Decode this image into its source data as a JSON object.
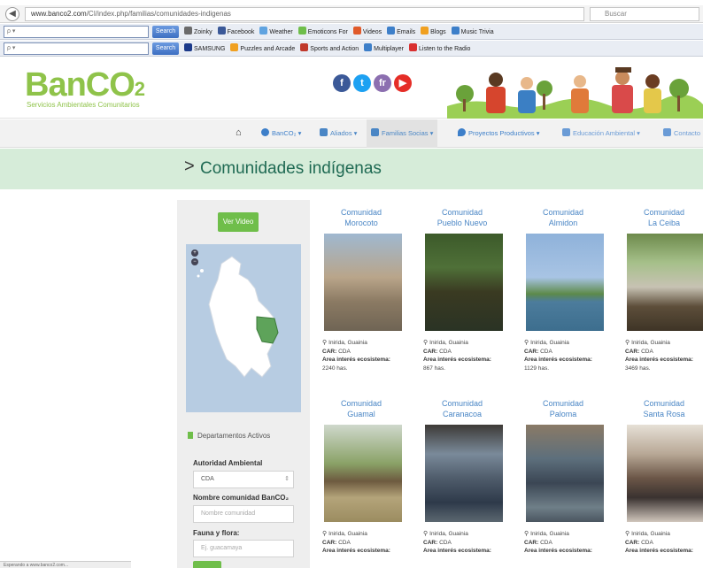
{
  "browser": {
    "url_host": "www.banco2.com",
    "url_path": "/CI/index.php/familias/comunidades-indigenas",
    "search_placeholder": "Buscar",
    "toolbar1_input": "",
    "toolbar2_input": "",
    "search_button": "Search",
    "toolbar1_items": [
      "Zoinky",
      "Facebook",
      "Weather",
      "Emoticons For",
      "Videos",
      "Emails",
      "Blogs",
      "Music Trivia"
    ],
    "toolbar2_items": [
      "SAMSUNG",
      "Puzzles and Arcade",
      "Sports and Action",
      "Multiplayer",
      "Listen to the Radio"
    ]
  },
  "header": {
    "logo_main": "BanCO",
    "logo_sub": "2",
    "tagline": "Servicios Ambientales Comunitarios",
    "social": [
      "f",
      "t",
      "fr",
      "▶"
    ]
  },
  "nav": {
    "home_icon": "home-icon",
    "items": [
      {
        "label": "BanCO₂ ▾",
        "color": "#3d7fc9"
      },
      {
        "label": "Aliados ▾",
        "color": "#4a86c5"
      },
      {
        "label": "Familias Socias ▾",
        "color": "#4a86c5"
      },
      {
        "label": "Proyectos Productivos ▾",
        "color": "#3d7fc9"
      },
      {
        "label": "Educación Ambiental ▾",
        "color": "#6a9bd6"
      },
      {
        "label": "Contacto",
        "color": "#6a9bd6"
      }
    ]
  },
  "page": {
    "title": "Comunidades indígenas"
  },
  "sidebar": {
    "video_button": "Ver Video",
    "legend": "Departamentos Activos",
    "authority_label": "Autoridad Ambiental",
    "authority_value": "CDA",
    "community_label": "Nombre comunidad BanCO₂",
    "community_placeholder": "Nombre comunidad",
    "fauna_label": "Fauna y flora:",
    "fauna_placeholder": "Ej. guacamaya"
  },
  "cards": [
    {
      "name1": "Comunidad",
      "name2": "Morocoto",
      "location": "Inirida, Guainia",
      "car": "CDA",
      "area_label": "Area interés ecosistema:",
      "area": "2240 has."
    },
    {
      "name1": "Comunidad",
      "name2": "Pueblo Nuevo",
      "location": "Inirida, Guainia",
      "car": "CDA",
      "area_label": "Area interés ecosistema:",
      "area": "867 has."
    },
    {
      "name1": "Comunidad",
      "name2": "Almidon",
      "location": "Inirida, Guainia",
      "car": "CDA",
      "area_label": "Area interés ecosistema:",
      "area": "1129 has."
    },
    {
      "name1": "Comunidad",
      "name2": "La Ceiba",
      "location": "Inirida, Guainia",
      "car": "CDA",
      "area_label": "Area interés ecosistema:",
      "area": "3469 has."
    },
    {
      "name1": "Comunidad",
      "name2": "Guamal",
      "location": "Inirida, Guainia",
      "car": "CDA",
      "area_label": "Area interés ecosistema:",
      "area": ""
    },
    {
      "name1": "Comunidad",
      "name2": "Caranacoa",
      "location": "Inirida, Guainia",
      "car": "CDA",
      "area_label": "Area interés ecosistema:",
      "area": ""
    },
    {
      "name1": "Comunidad",
      "name2": "Paloma",
      "location": "Inirida, Guainia",
      "car": "CDA",
      "area_label": "Area interés ecosistema:",
      "area": ""
    },
    {
      "name1": "Comunidad",
      "name2": "Santa Rosa",
      "location": "Inirida, Guainia",
      "car": "CDA",
      "area_label": "Area interés ecosistema:",
      "area": ""
    }
  ],
  "car_label": "CAR:",
  "status_bar": "Esperando a www.banco2.com...",
  "colors": {
    "brand_green": "#8fc34a",
    "button_green": "#6fbe4a",
    "title_band": "#d6ecd9",
    "link_blue": "#4a86c5",
    "title_text": "#1f6a53"
  }
}
